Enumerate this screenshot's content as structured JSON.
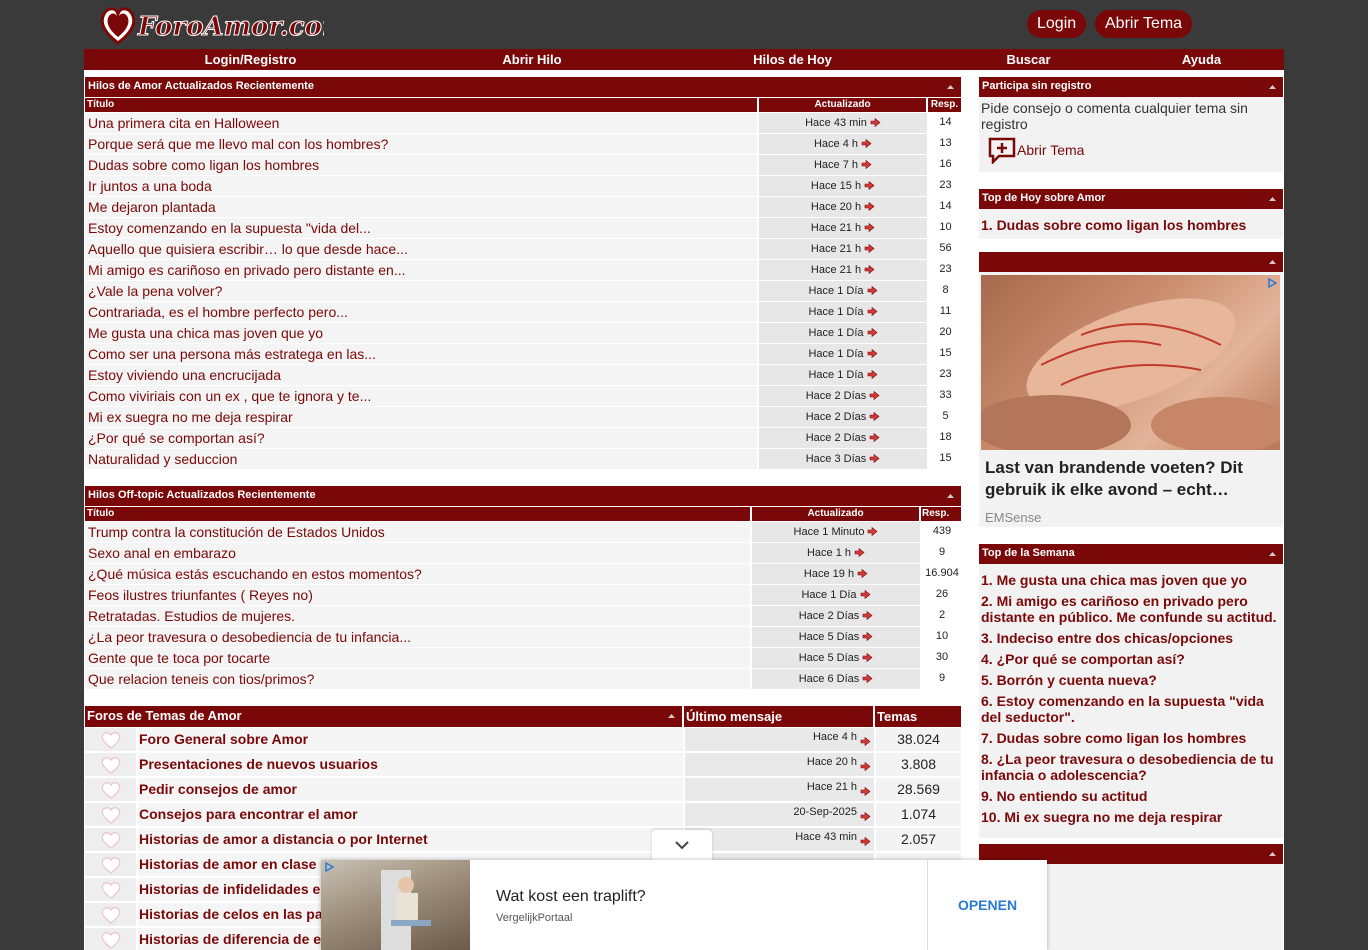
{
  "brand": {
    "logo_text": "ForoAmor.com"
  },
  "top_buttons": {
    "login": "Login",
    "open_topic": "Abrir Tema"
  },
  "nav": [
    "Login/Registro",
    "Abrir Hilo",
    "Hilos de Hoy",
    "Buscar",
    "Ayuda"
  ],
  "love_threads": {
    "title": "Hilos de Amor Actualizados Recientemente",
    "col_title": "Título",
    "col_updated": "Actualizado",
    "col_resp": "Resp.",
    "rows": [
      {
        "t": "Una primera cita en Halloween",
        "u": "Hace 43 min",
        "r": "14"
      },
      {
        "t": "Porque será que me llevo mal con los hombres?",
        "u": "Hace 4 h",
        "r": "13"
      },
      {
        "t": "Dudas sobre como ligan los hombres",
        "u": "Hace 7 h",
        "r": "16"
      },
      {
        "t": "Ir juntos a una boda",
        "u": "Hace 15 h",
        "r": "23"
      },
      {
        "t": "Me dejaron plantada",
        "u": "Hace 20 h",
        "r": "14"
      },
      {
        "t": "Estoy comenzando en la supuesta \"vida del...",
        "u": "Hace 21 h",
        "r": "10"
      },
      {
        "t": "Aquello que quisiera escribir… lo que desde hace...",
        "u": "Hace 21 h",
        "r": "56"
      },
      {
        "t": "Mi amigo es cariñoso en privado pero distante en...",
        "u": "Hace 21 h",
        "r": "23"
      },
      {
        "t": "¿Vale la pena volver?",
        "u": "Hace 1 Día",
        "r": "8"
      },
      {
        "t": "Contrariada, es el hombre perfecto pero...",
        "u": "Hace 1 Día",
        "r": "11"
      },
      {
        "t": "Me gusta una chica mas joven que yo",
        "u": "Hace 1 Día",
        "r": "20"
      },
      {
        "t": "Como ser una persona más estratega en las...",
        "u": "Hace 1 Día",
        "r": "15"
      },
      {
        "t": "Estoy viviendo una encrucijada",
        "u": "Hace 1 Día",
        "r": "23"
      },
      {
        "t": "Como viviriais con un ex , que te ignora y te...",
        "u": "Hace 2 Días",
        "r": "33"
      },
      {
        "t": "Mi ex suegra no me deja respirar",
        "u": "Hace 2 Días",
        "r": "5"
      },
      {
        "t": "¿Por qué se comportan así?",
        "u": "Hace 2 Días",
        "r": "18"
      },
      {
        "t": "Naturalidad y seduccion",
        "u": "Hace 3 Días",
        "r": "15"
      }
    ]
  },
  "offtopic_threads": {
    "title": "Hilos Off-topic Actualizados Recientemente",
    "col_title": "Título",
    "col_updated": "Actualizado",
    "col_resp": "Resp.",
    "rows": [
      {
        "t": "Trump contra la constitución de Estados Unidos",
        "u": "Hace 1 Minuto",
        "r": "439"
      },
      {
        "t": "Sexo anal en embarazo",
        "u": "Hace 1 h",
        "r": "9"
      },
      {
        "t": "¿Qué música estás escuchando en estos momentos?",
        "u": "Hace 19 h",
        "r": "16.904"
      },
      {
        "t": "Feos ilustres triunfantes ( Reyes no)",
        "u": "Hace 1 Día",
        "r": "26"
      },
      {
        "t": "Retratadas. Estudios de mujeres.",
        "u": "Hace 2 Días",
        "r": "2"
      },
      {
        "t": "¿La peor travesura o desobediencia de tu infancia...",
        "u": "Hace 5 Días",
        "r": "10"
      },
      {
        "t": "Gente que te toca por tocarte",
        "u": "Hace 5 Días",
        "r": "30"
      },
      {
        "t": "Que relacion teneis con tios/primos?",
        "u": "Hace 6 Días",
        "r": "9"
      }
    ]
  },
  "forums": {
    "title": "Foros de Temas de Amor",
    "col_last": "Último mensaje",
    "col_topics": "Temas",
    "rows": [
      {
        "name": "Foro General sobre Amor",
        "last": "Hace 4 h",
        "count": "38.024"
      },
      {
        "name": "Presentaciones de nuevos usuarios",
        "last": "Hace 20 h",
        "count": "3.808"
      },
      {
        "name": "Pedir consejos de amor",
        "last": "Hace 21 h",
        "count": "28.569"
      },
      {
        "name": "Consejos para encontrar el amor",
        "last": "20-Sep-2025",
        "count": "1.074"
      },
      {
        "name": "Historias de amor a distancia o por Internet",
        "last": "Hace 43 min",
        "count": "2.057"
      },
      {
        "name": "Historias de amor en clase",
        "last": "",
        "count": ""
      },
      {
        "name": "Historias de infidelidades e",
        "last": "",
        "count": ""
      },
      {
        "name": "Historias de celos en las pa",
        "last": "",
        "count": ""
      },
      {
        "name": "Historias de diferencia de e",
        "last": "",
        "count": ""
      }
    ]
  },
  "sidebar": {
    "participate": {
      "title": "Participa sin registro",
      "text": "Pide consejo o comenta cualquier tema sin registro",
      "button": "Abrir Tema"
    },
    "top_today": {
      "title": "Top de Hoy sobre Amor",
      "items": [
        "1. Dudas sobre como ligan los hombres"
      ]
    },
    "ad": {
      "headline": "Last van brandende voeten? Dit gebruik ik elke avond – echt…",
      "source": "EMSense"
    },
    "top_week": {
      "title": "Top de la Semana",
      "items": [
        "1. Me gusta una chica mas joven que yo",
        "2. Mi amigo es cariñoso en privado pero distante en público. Me confunde su actitud.",
        "3. Indeciso entre dos chicas/opciones",
        "4. ¿Por qué se comportan así?",
        "5. Borrón y cuenta nueva?",
        "6. Estoy comenzando en la supuesta \"vida del seductor\".",
        "7. Dudas sobre como ligan los hombres",
        "8. ¿La peor travesura o desobediencia de tu infancia o adolescencia?",
        "9. No entiendo su actitud",
        "10. Mi ex suegra no me deja respirar"
      ]
    }
  },
  "bottom_ad": {
    "title": "Wat kost een traplift?",
    "source": "VergelijkPortaal",
    "cta": "OPENEN"
  },
  "colors": {
    "brand": "#7a0808",
    "background": "#3a3a3a"
  }
}
